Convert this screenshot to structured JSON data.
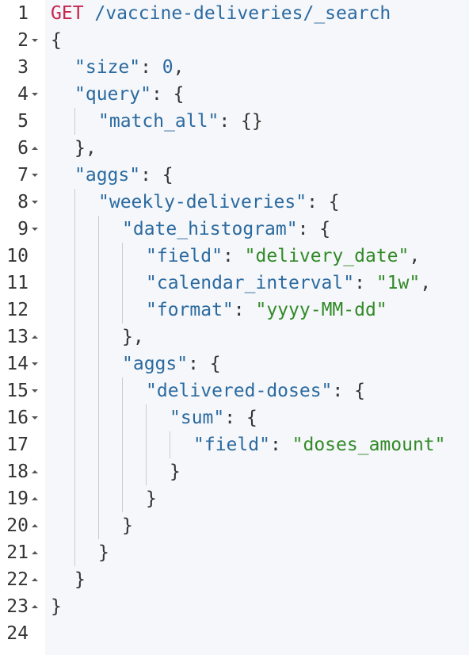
{
  "editor": {
    "theme": {
      "method_color": "#c7254e",
      "key_color": "#2b6aa0",
      "string_color": "#328a28",
      "text_color": "#333333",
      "background": "#f5f7fa"
    },
    "request": {
      "method": "GET",
      "path": " /vaccine-deliveries/_search"
    },
    "lines": [
      {
        "num": "1",
        "fold": "",
        "depth": 0,
        "tokens": []
      },
      {
        "num": "2",
        "fold": "down",
        "depth": 0,
        "tokens": [
          [
            "p",
            "{"
          ]
        ]
      },
      {
        "num": "3",
        "fold": "",
        "depth": 1,
        "tokens": [
          [
            "k",
            "\"size\""
          ],
          [
            "p",
            ": "
          ],
          [
            "n",
            "0"
          ],
          [
            "p",
            ","
          ]
        ]
      },
      {
        "num": "4",
        "fold": "down",
        "depth": 1,
        "tokens": [
          [
            "k",
            "\"query\""
          ],
          [
            "p",
            ": {"
          ]
        ]
      },
      {
        "num": "5",
        "fold": "",
        "depth": 2,
        "tokens": [
          [
            "k",
            "\"match_all\""
          ],
          [
            "p",
            ": {}"
          ]
        ]
      },
      {
        "num": "6",
        "fold": "up",
        "depth": 1,
        "tokens": [
          [
            "p",
            "},"
          ]
        ]
      },
      {
        "num": "7",
        "fold": "down",
        "depth": 1,
        "tokens": [
          [
            "k",
            "\"aggs\""
          ],
          [
            "p",
            ": {"
          ]
        ]
      },
      {
        "num": "8",
        "fold": "down",
        "depth": 2,
        "tokens": [
          [
            "k",
            "\"weekly-deliveries\""
          ],
          [
            "p",
            ": {"
          ]
        ]
      },
      {
        "num": "9",
        "fold": "down",
        "depth": 3,
        "tokens": [
          [
            "k",
            "\"date_histogram\""
          ],
          [
            "p",
            ": {"
          ]
        ]
      },
      {
        "num": "10",
        "fold": "",
        "depth": 4,
        "tokens": [
          [
            "k",
            "\"field\""
          ],
          [
            "p",
            ": "
          ],
          [
            "s",
            "\"delivery_date\""
          ],
          [
            "p",
            ","
          ]
        ]
      },
      {
        "num": "11",
        "fold": "",
        "depth": 4,
        "tokens": [
          [
            "k",
            "\"calendar_interval\""
          ],
          [
            "p",
            ": "
          ],
          [
            "s",
            "\"1w\""
          ],
          [
            "p",
            ","
          ]
        ]
      },
      {
        "num": "12",
        "fold": "",
        "depth": 4,
        "tokens": [
          [
            "k",
            "\"format\""
          ],
          [
            "p",
            ": "
          ],
          [
            "s",
            "\"yyyy-MM-dd\""
          ]
        ]
      },
      {
        "num": "13",
        "fold": "up",
        "depth": 3,
        "tokens": [
          [
            "p",
            "},"
          ]
        ]
      },
      {
        "num": "14",
        "fold": "down",
        "depth": 3,
        "tokens": [
          [
            "k",
            "\"aggs\""
          ],
          [
            "p",
            ": {"
          ]
        ]
      },
      {
        "num": "15",
        "fold": "down",
        "depth": 4,
        "tokens": [
          [
            "k",
            "\"delivered-doses\""
          ],
          [
            "p",
            ": {"
          ]
        ]
      },
      {
        "num": "16",
        "fold": "down",
        "depth": 5,
        "tokens": [
          [
            "k",
            "\"sum\""
          ],
          [
            "p",
            ": {"
          ]
        ]
      },
      {
        "num": "17",
        "fold": "",
        "depth": 6,
        "tokens": [
          [
            "k",
            "\"field\""
          ],
          [
            "p",
            ": "
          ],
          [
            "s",
            "\"doses_amount\""
          ]
        ]
      },
      {
        "num": "18",
        "fold": "up",
        "depth": 5,
        "tokens": [
          [
            "p",
            "}"
          ]
        ]
      },
      {
        "num": "19",
        "fold": "up",
        "depth": 4,
        "tokens": [
          [
            "p",
            "}"
          ]
        ]
      },
      {
        "num": "20",
        "fold": "up",
        "depth": 3,
        "tokens": [
          [
            "p",
            "}"
          ]
        ]
      },
      {
        "num": "21",
        "fold": "up",
        "depth": 2,
        "tokens": [
          [
            "p",
            "}"
          ]
        ]
      },
      {
        "num": "22",
        "fold": "up",
        "depth": 1,
        "tokens": [
          [
            "p",
            "}"
          ]
        ]
      },
      {
        "num": "23",
        "fold": "up",
        "depth": 0,
        "tokens": [
          [
            "p",
            "}"
          ]
        ]
      },
      {
        "num": "24",
        "fold": "",
        "depth": 0,
        "tokens": []
      }
    ]
  }
}
